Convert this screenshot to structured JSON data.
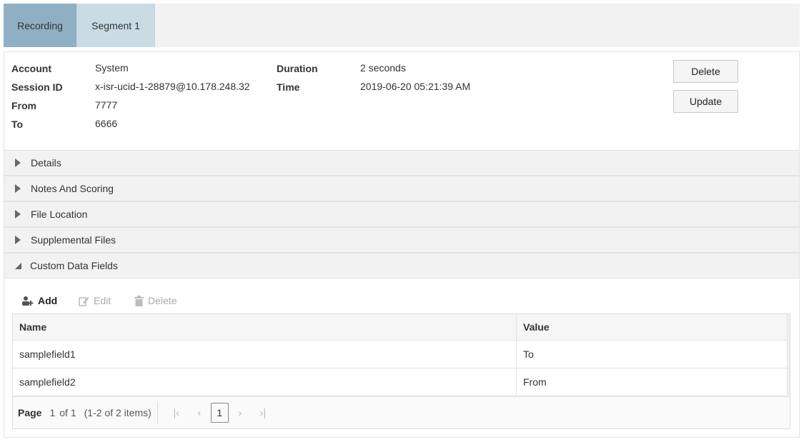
{
  "tabs": [
    {
      "label": "Recording",
      "active": true
    },
    {
      "label": "Segment 1",
      "active": false
    }
  ],
  "info": {
    "left": [
      {
        "label": "Account",
        "value": "System"
      },
      {
        "label": "Session ID",
        "value": "x-isr-ucid-1-28879@10.178.248.32"
      },
      {
        "label": "From",
        "value": "7777"
      },
      {
        "label": "To",
        "value": "6666"
      }
    ],
    "right": [
      {
        "label": "Duration",
        "value": "2 seconds"
      },
      {
        "label": "Time",
        "value": "2019-06-20 05:21:39 AM"
      }
    ]
  },
  "buttons": {
    "delete": "Delete",
    "update": "Update"
  },
  "accordion": [
    {
      "label": "Details",
      "expanded": false
    },
    {
      "label": "Notes And Scoring",
      "expanded": false
    },
    {
      "label": "File Location",
      "expanded": false
    },
    {
      "label": "Supplemental Files",
      "expanded": false
    },
    {
      "label": "Custom Data Fields",
      "expanded": true
    }
  ],
  "toolbar": {
    "add": "Add",
    "edit": "Edit",
    "delete": "Delete"
  },
  "grid": {
    "columns": [
      "Name",
      "Value"
    ],
    "rows": [
      [
        "samplefield1",
        "To"
      ],
      [
        "samplefield2",
        "From"
      ]
    ]
  },
  "pager": {
    "label": "Page",
    "current": "1",
    "of": "of 1",
    "summary": "(1-2 of 2 items)",
    "page_button": "1"
  },
  "colors": {
    "tab_active": "#8fb0c4",
    "tab_inactive": "#c9dbe4"
  }
}
